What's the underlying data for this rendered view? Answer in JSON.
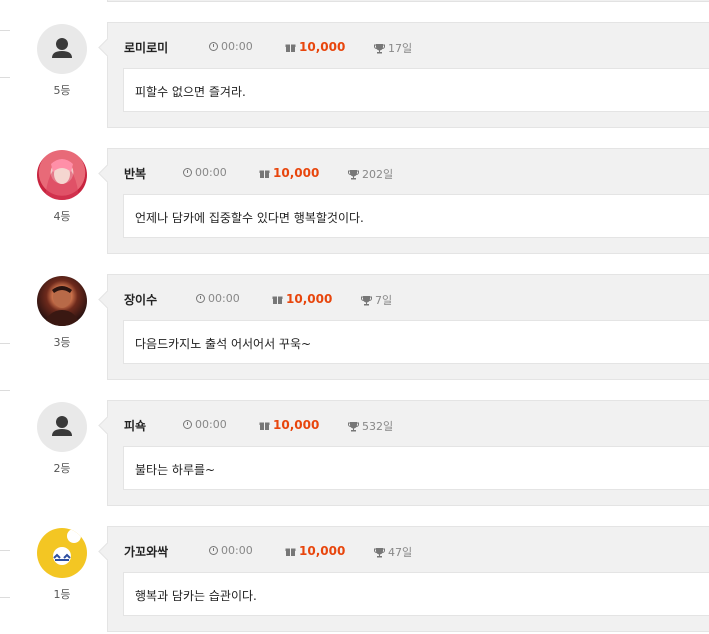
{
  "entries": [
    {
      "rank": "5등",
      "name": "로미로미",
      "time": "00:00",
      "points": "10,000",
      "days": "17일",
      "message": "피할수 없으면 즐겨라.",
      "avatar": "default-avatar-icon"
    },
    {
      "rank": "4등",
      "name": "반복",
      "time": "00:00",
      "points": "10,000",
      "days": "202일",
      "message": "언제나 담카에 집중할수 있다면 행복할것이다.",
      "avatar": "photo-pink-hair"
    },
    {
      "rank": "3등",
      "name": "장이수",
      "time": "00:00",
      "points": "10,000",
      "days": "7일",
      "message": "다음드카지노 출석 어서어서 꾸욱~",
      "avatar": "photo-man"
    },
    {
      "rank": "2등",
      "name": "피쇽",
      "time": "00:00",
      "points": "10,000",
      "days": "532일",
      "message": "불타는 하루를~",
      "avatar": "default-avatar-icon"
    },
    {
      "rank": "1등",
      "name": "가꼬와싹",
      "time": "00:00",
      "points": "10,000",
      "days": "47일",
      "message": "행복과 담카는 습관이다.",
      "avatar": "yellow-character"
    }
  ],
  "colors": {
    "points": "#e8460d",
    "card": "#f1f1f1",
    "border": "#e4e4e4"
  }
}
